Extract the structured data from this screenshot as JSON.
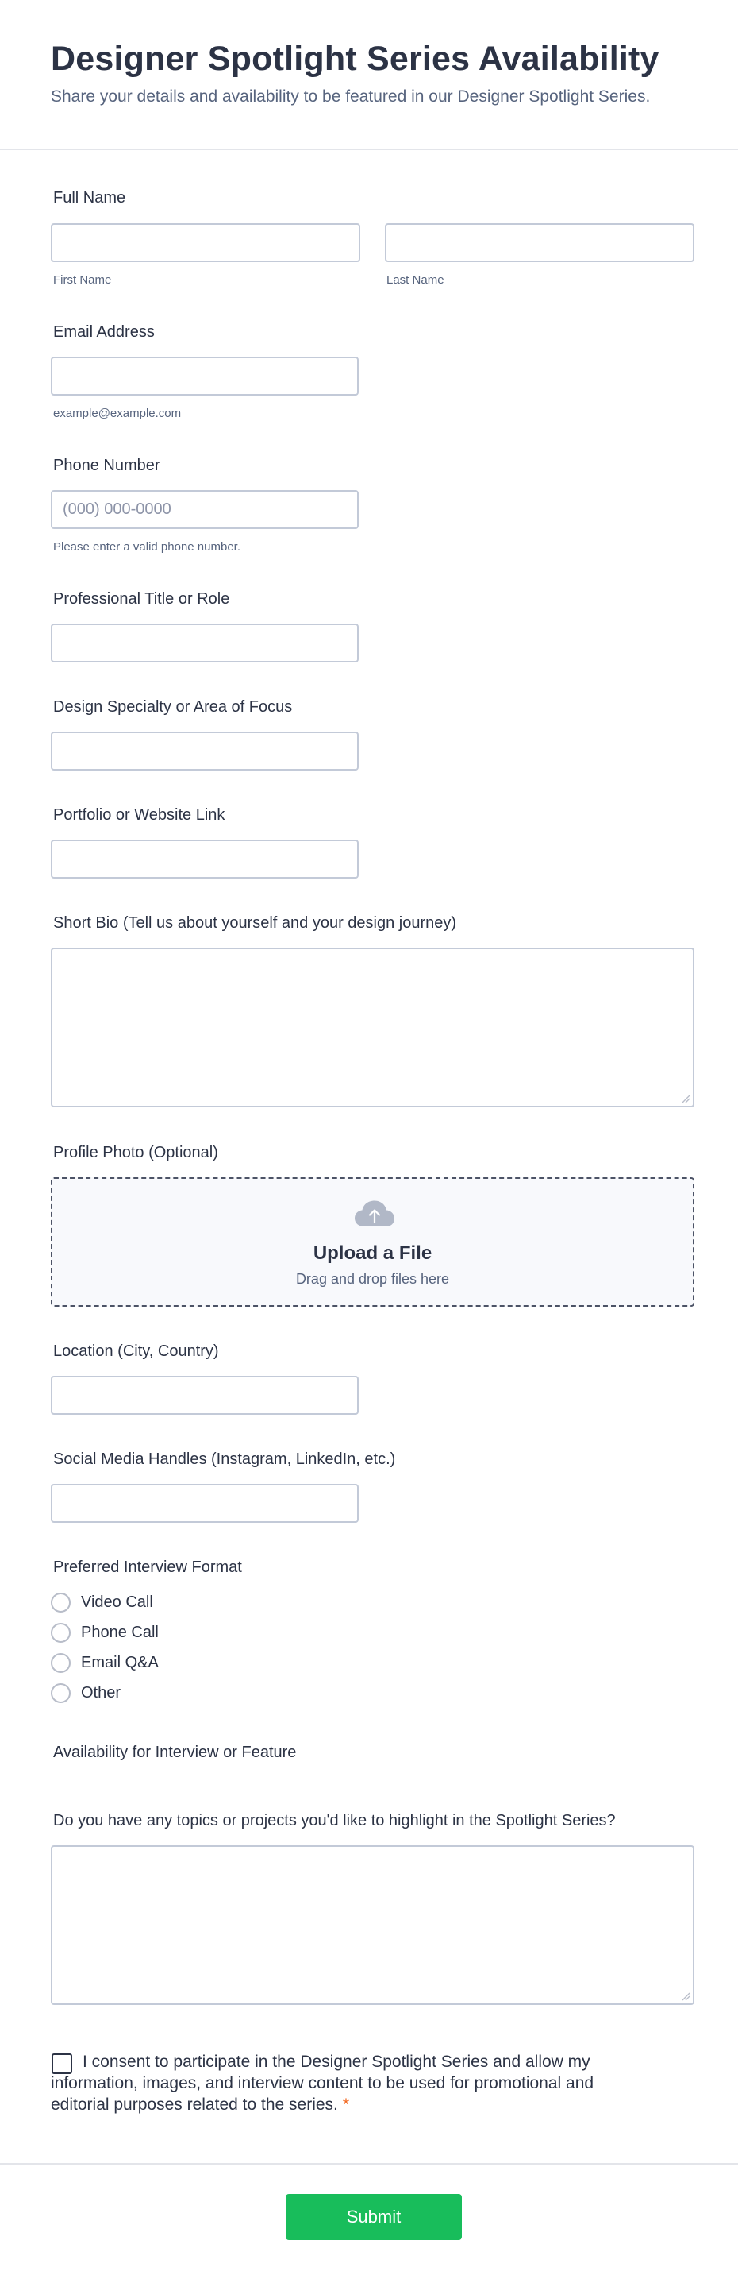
{
  "form": {
    "title": "Designer Spotlight Series Availability",
    "subtitle": "Share your details and availability to be featured in our Designer Spotlight Series."
  },
  "full_name": {
    "label": "Full Name",
    "first_sublabel": "First Name",
    "last_sublabel": "Last Name",
    "first_value": "",
    "last_value": ""
  },
  "email": {
    "label": "Email Address",
    "value": "",
    "sublabel": "example@example.com"
  },
  "phone": {
    "label": "Phone Number",
    "value": "",
    "placeholder": "(000) 000-0000",
    "sublabel": "Please enter a valid phone number."
  },
  "title_role": {
    "label": "Professional Title or Role",
    "value": ""
  },
  "specialty": {
    "label": "Design Specialty or Area of Focus",
    "value": ""
  },
  "portfolio": {
    "label": "Portfolio or Website Link",
    "value": ""
  },
  "bio": {
    "label": "Short Bio (Tell us about yourself and your design journey)",
    "value": ""
  },
  "photo": {
    "label": "Profile Photo (Optional)",
    "upload_title": "Upload a File",
    "upload_hint": "Drag and drop files here",
    "icon": "cloud-upload-icon"
  },
  "location": {
    "label": "Location (City, Country)",
    "value": ""
  },
  "social": {
    "label": "Social Media Handles (Instagram, LinkedIn, etc.)",
    "value": ""
  },
  "interview_format": {
    "label": "Preferred Interview Format",
    "options": [
      "Video Call",
      "Phone Call",
      "Email Q&A",
      "Other"
    ]
  },
  "availability": {
    "label": "Availability for Interview or Feature"
  },
  "topics": {
    "label": "Do you have any topics or projects you'd like to highlight in the Spotlight Series?",
    "value": ""
  },
  "consent": {
    "text": "I consent to participate in the Designer Spotlight Series and allow my information, images, and interview content to be used for promotional and editorial purposes related to the series.",
    "required_mark": "*",
    "checked": false
  },
  "submit": {
    "label": "Submit"
  },
  "colors": {
    "submit": "#18bd5b",
    "required": "#f2671f",
    "text": "#2c3345",
    "muted": "#57647e",
    "border": "#c3cad8"
  }
}
